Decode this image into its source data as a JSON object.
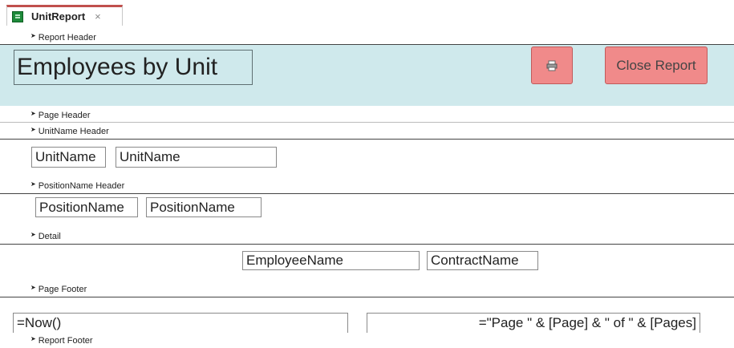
{
  "tab": {
    "title": "UnitReport",
    "close_glyph": "×"
  },
  "sections": {
    "report_header": "Report Header",
    "page_header": "Page Header",
    "unitname_header": "UnitName Header",
    "positionname_header": "PositionName Header",
    "detail": "Detail",
    "page_footer": "Page Footer",
    "report_footer": "Report Footer"
  },
  "report_header": {
    "title": "Employees by Unit",
    "print_button_icon": "printer-icon",
    "close_button_label": "Close Report"
  },
  "unit_header": {
    "label": "UnitName",
    "field": "UnitName"
  },
  "position_header": {
    "label": "PositionName",
    "field": "PositionName"
  },
  "detail": {
    "employee_field": "EmployeeName",
    "contract_field": "ContractName"
  },
  "page_footer": {
    "now_field": "=Now()",
    "page_field": "=\"Page \" & [Page] & \" of \" & [Pages]"
  },
  "colors": {
    "header_band": "#cfe9ec",
    "button_fill": "#f08a8a",
    "tab_accent": "#c0504d"
  }
}
